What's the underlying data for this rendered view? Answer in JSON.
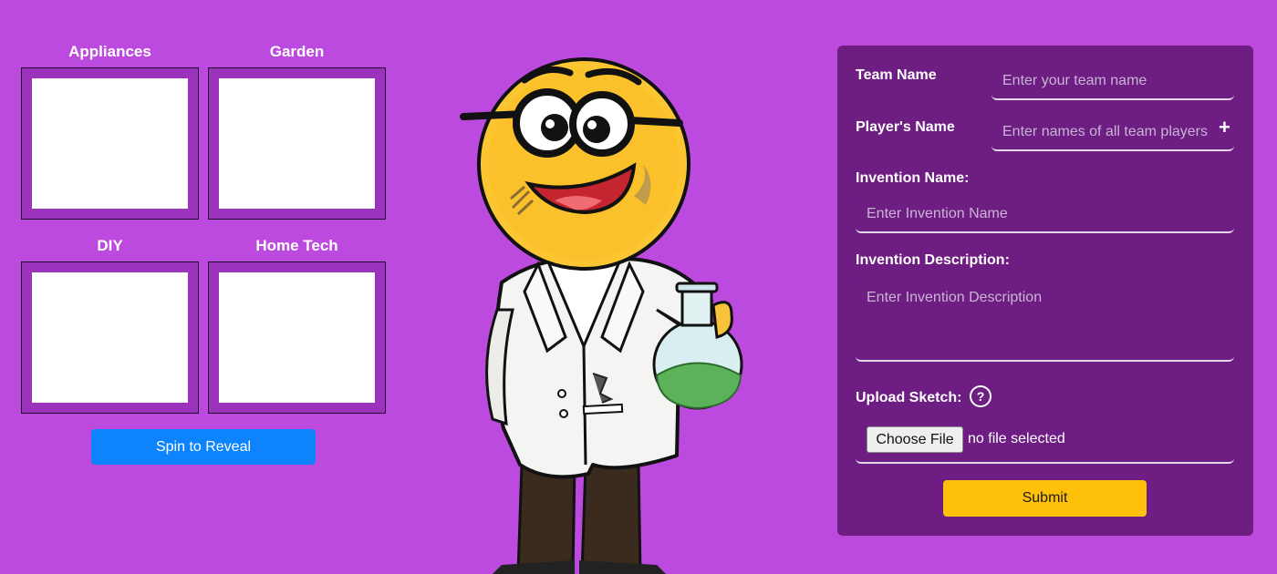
{
  "categories": [
    {
      "label": "Appliances"
    },
    {
      "label": "Garden"
    },
    {
      "label": "DIY"
    },
    {
      "label": "Home Tech"
    }
  ],
  "spin_button": {
    "label": "Spin to Reveal"
  },
  "form": {
    "team_name": {
      "label": "Team Name",
      "placeholder": "Enter your team name",
      "value": ""
    },
    "players_name": {
      "label": "Player's Name",
      "placeholder": "Enter names of all team players",
      "value": "",
      "add_icon": "plus-icon"
    },
    "invention_name": {
      "label": "Invention Name:",
      "placeholder": "Enter Invention Name",
      "value": ""
    },
    "invention_description": {
      "label": "Invention Description:",
      "placeholder": "Enter Invention Description",
      "value": ""
    },
    "upload_sketch": {
      "label": "Upload Sketch:",
      "help_icon": "question-circle-icon",
      "button_label": "Choose File",
      "status": "no file selected"
    },
    "submit_label": "Submit"
  },
  "colors": {
    "page_background": "#bd4ade",
    "panel_background": "#6e1d83",
    "spin_button": "#0d84fb",
    "submit_button": "#ffc009"
  }
}
